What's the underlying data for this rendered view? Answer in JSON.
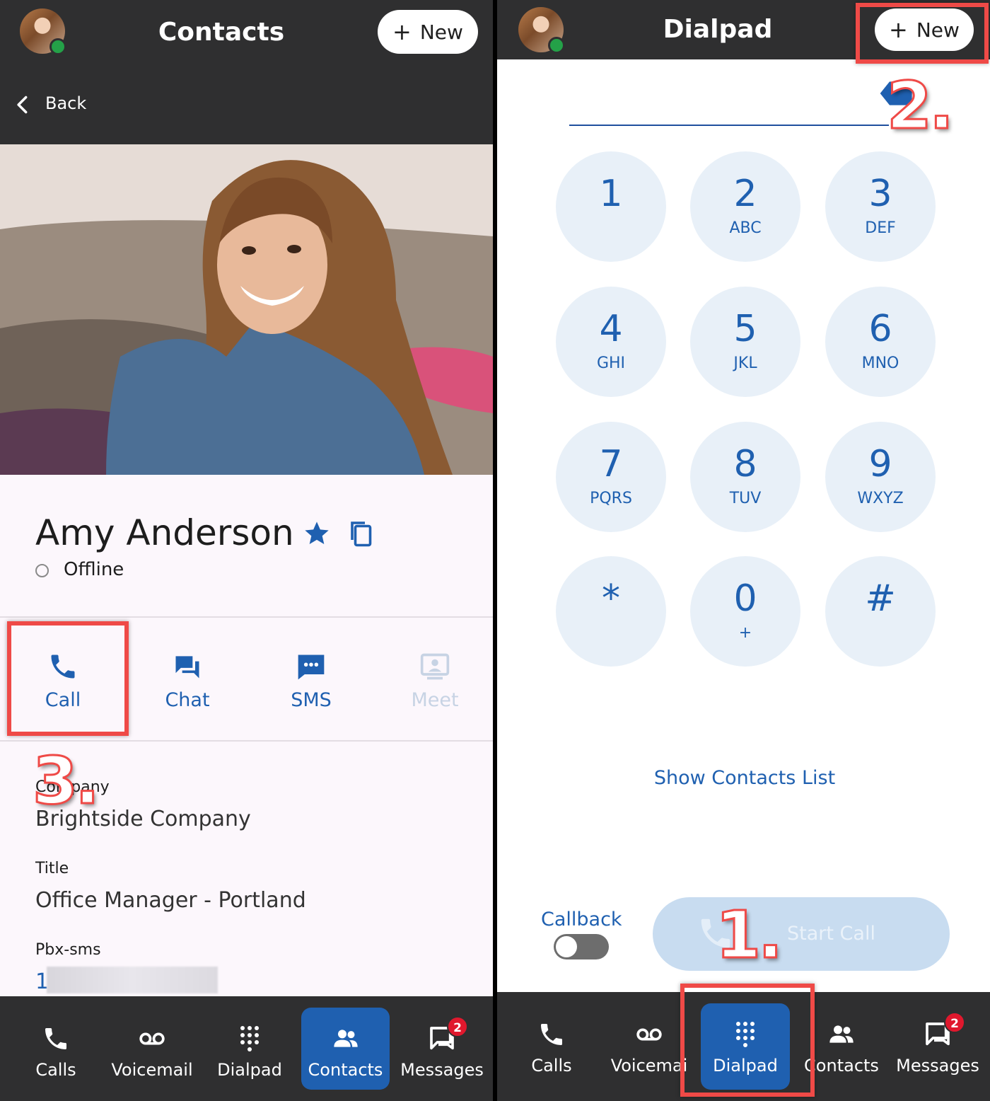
{
  "left_panel": {
    "header": {
      "title": "Contacts",
      "new_label": "New"
    },
    "back_label": "Back",
    "contact": {
      "name": "Amy Anderson",
      "status": "Offline",
      "actions": [
        "Call",
        "Chat",
        "SMS",
        "Meet"
      ],
      "company_label": "Company",
      "company_value": "Brightside Company",
      "title_label": "Title",
      "title_value": "Office Manager - Portland",
      "pbx_label": "Pbx-sms",
      "pbx_value": "1"
    },
    "tabbar": {
      "tabs": [
        "Calls",
        "Voicemail",
        "Dialpad",
        "Contacts",
        "Messages"
      ],
      "active": "Contacts",
      "messages_badge": "2"
    }
  },
  "right_panel": {
    "header": {
      "title": "Dialpad",
      "new_label": "New"
    },
    "keys": [
      {
        "digit": "1",
        "letters": ""
      },
      {
        "digit": "2",
        "letters": "ABC"
      },
      {
        "digit": "3",
        "letters": "DEF"
      },
      {
        "digit": "4",
        "letters": "GHI"
      },
      {
        "digit": "5",
        "letters": "JKL"
      },
      {
        "digit": "6",
        "letters": "MNO"
      },
      {
        "digit": "7",
        "letters": "PQRS"
      },
      {
        "digit": "8",
        "letters": "TUV"
      },
      {
        "digit": "9",
        "letters": "WXYZ"
      },
      {
        "digit": "*",
        "letters": ""
      },
      {
        "digit": "0",
        "letters": "+"
      },
      {
        "digit": "#",
        "letters": ""
      }
    ],
    "show_contacts_label": "Show Contacts List",
    "callback_label": "Callback",
    "callback_enabled": false,
    "start_call_label": "Start Call",
    "tabbar": {
      "tabs": [
        "Calls",
        "Voicemai",
        "Dialpad",
        "Contacts",
        "Messages"
      ],
      "active": "Dialpad",
      "messages_badge": "2"
    }
  },
  "annotations": {
    "step1": "1.",
    "step2": "2.",
    "step3": "3.",
    "highlight_color": "#ef4a47"
  },
  "colors": {
    "header_bg": "#2f2f30",
    "accent": "#1f60b0",
    "key_bg": "#e8f0f8",
    "presence_online": "#24a148",
    "badge": "#e0182d"
  },
  "icons": [
    "chevron-left-icon",
    "star-icon",
    "copy-icon",
    "phone-icon",
    "chat-icon",
    "sms-icon",
    "meet-icon",
    "voicemail-icon",
    "dialpad-icon",
    "contacts-icon",
    "messages-icon",
    "backspace-icon",
    "plus-icon"
  ]
}
